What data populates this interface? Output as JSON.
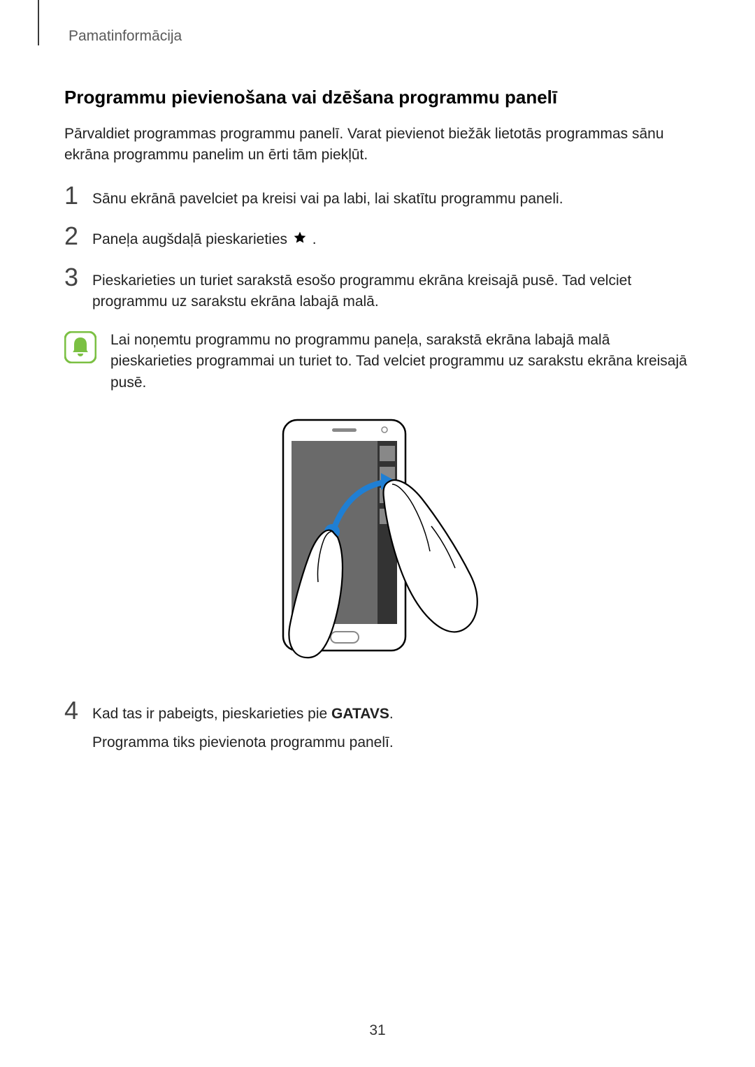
{
  "header": {
    "label": "Pamatinformācija"
  },
  "section": {
    "title": "Programmu pievienošana vai dzēšana programmu panelī",
    "intro": "Pārvaldiet programmas programmu panelī. Varat pievienot biežāk lietotās programmas sānu ekrāna programmu panelim un ērti tām piekļūt."
  },
  "steps": {
    "s1": {
      "num": "1",
      "text": "Sānu ekrānā pavelciet pa kreisi vai pa labi, lai skatītu programmu paneli."
    },
    "s2": {
      "num": "2",
      "text_pre": "Paneļa augšdaļā pieskarieties ",
      "text_post": "."
    },
    "s3": {
      "num": "3",
      "text": "Pieskarieties un turiet sarakstā esošo programmu ekrāna kreisajā pusē. Tad velciet programmu uz sarakstu ekrāna labajā malā."
    },
    "s4": {
      "num": "4",
      "line1_pre": "Kad tas ir pabeigts, pieskarieties pie ",
      "line1_bold": "GATAVS",
      "line1_post": ".",
      "line2": "Programma tiks pievienota programmu panelī."
    }
  },
  "note": {
    "text": "Lai noņemtu programmu no programmu paneļa, sarakstā ekrāna labajā malā pieskarieties programmai un turiet to. Tad velciet programmu uz sarakstu ekrāna kreisajā pusē."
  },
  "footer": {
    "page_number": "31"
  }
}
